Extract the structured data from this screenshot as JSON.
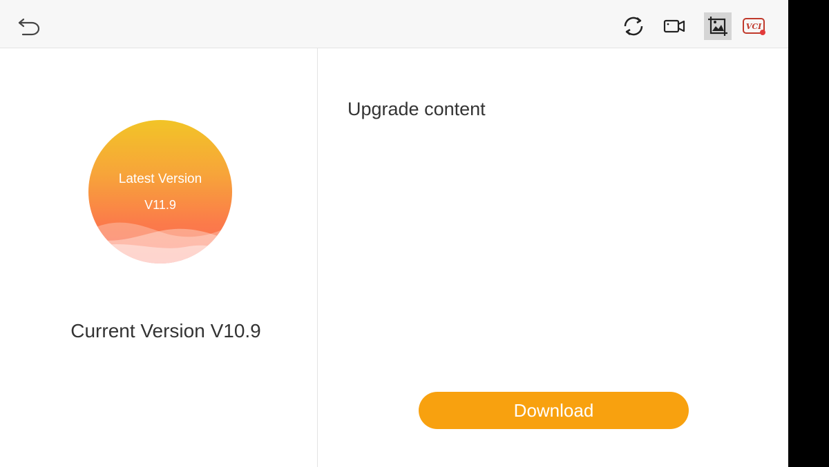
{
  "toolbar": {
    "back_icon": "back-arrow-icon",
    "refresh_icon": "refresh-icon",
    "record_icon": "video-record-icon",
    "screenshot_icon": "screenshot-icon",
    "vci_icon": "vci-icon",
    "vci_text": "VCI"
  },
  "version_panel": {
    "latest_label": "Latest Version",
    "latest_version": "V11.9",
    "current_version": "Current Version V10.9"
  },
  "upgrade_panel": {
    "title": "Upgrade content",
    "download_label": "Download"
  },
  "colors": {
    "accent": "#f8a10f",
    "circle_top": "#f2c427",
    "circle_bottom": "#fc6a56",
    "text_dark": "#333333"
  }
}
